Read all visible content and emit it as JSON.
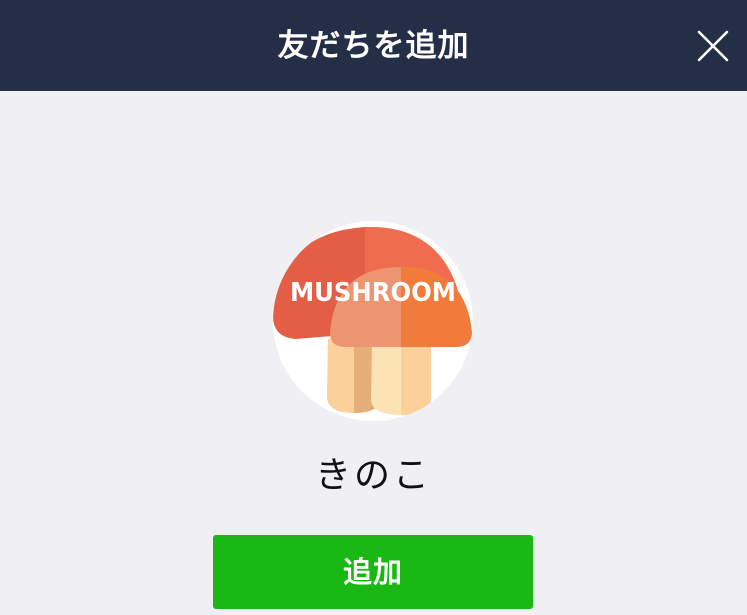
{
  "header": {
    "title": "友だちを追加",
    "close_icon": "close-icon"
  },
  "profile": {
    "avatar_text": "MUSHROOM",
    "avatar_icon": "mushroom-icon",
    "name": "きのこ"
  },
  "actions": {
    "add_label": "追加"
  },
  "colors": {
    "header_bg": "#252e47",
    "page_bg": "#efeff4",
    "add_button": "#1ab815",
    "mushroom_back_cap": "#e35e45",
    "mushroom_front_cap": "#f07b3a",
    "mushroom_stem": "#fbd09a"
  }
}
